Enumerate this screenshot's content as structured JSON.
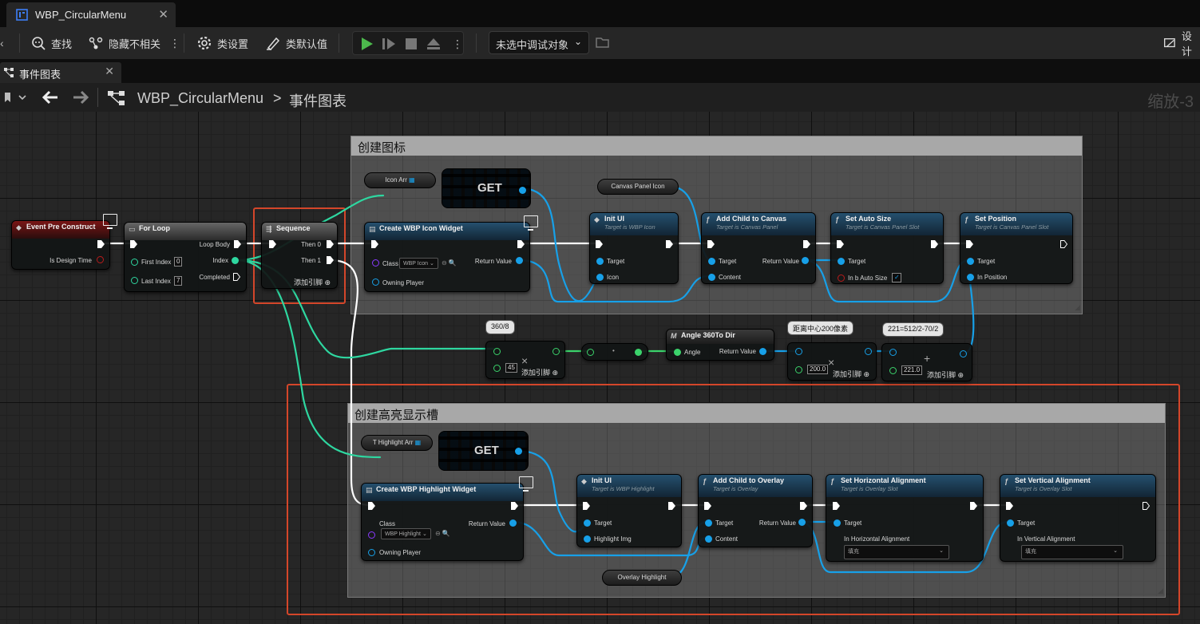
{
  "window": {
    "asset_title": "WBP_CircularMenu",
    "close": "✕"
  },
  "toolbar": {
    "find": "查找",
    "hide_unrelated": "隐藏不相关",
    "class_settings": "类设置",
    "class_defaults": "类默认值",
    "debug_target": "未选中调试对象",
    "designer": "设计",
    "more": "⋮"
  },
  "tabs": {
    "event_graph": "事件图表",
    "close": "✕"
  },
  "breadcrumb": {
    "asset": "WBP_CircularMenu",
    "separator": ">",
    "graph": "事件图表",
    "zoom": "缩放-3"
  },
  "comments": {
    "create_icons": "创建图标",
    "create_highlight": "创建高亮显示槽"
  },
  "nodes": {
    "event_pre_construct": {
      "title": "Event Pre Construct",
      "pin_design_time": "Is Design Time"
    },
    "for_loop": {
      "title": "For Loop",
      "first_index": "First Index",
      "first_index_value": "0",
      "last_index": "Last Index",
      "last_index_value": "7",
      "loop_body": "Loop Body",
      "index": "Index",
      "completed": "Completed"
    },
    "sequence": {
      "title": "Sequence",
      "then0": "Then 0",
      "then1": "Then 1",
      "add_pin": "添加引脚"
    },
    "icon_arr": {
      "label": "Icon Arr"
    },
    "get1": {
      "label": "GET"
    },
    "canvas_panel_icon": {
      "label": "Canvas Panel Icon"
    },
    "create_icon_widget": {
      "title": "Create WBP Icon Widget",
      "class": "Class",
      "class_value": "WBP Icon",
      "owning_player": "Owning Player",
      "return_value": "Return Value"
    },
    "init_ui_1": {
      "title": "Init UI",
      "subtitle": "Target is WBP Icon",
      "target": "Target",
      "icon": "Icon"
    },
    "add_child_canvas": {
      "title": "Add Child to Canvas",
      "subtitle": "Target is Canvas Panel",
      "target": "Target",
      "content": "Content",
      "return_value": "Return Value"
    },
    "set_auto_size": {
      "title": "Set Auto Size",
      "subtitle": "Target is Canvas Panel Slot",
      "target": "Target",
      "in_b_auto_size": "In b Auto Size",
      "checked": "✓"
    },
    "set_position": {
      "title": "Set Position",
      "subtitle": "Target is Canvas Panel Slot",
      "target": "Target",
      "in_position": "In Position"
    },
    "multiply_angle": {
      "comment": "360/8",
      "value": "45",
      "add_pin": "添加引脚",
      "op": "×"
    },
    "convert_node": {
      "op": "•"
    },
    "angle_dir": {
      "title": "Angle 360To Dir",
      "angle": "Angle",
      "return_value": "Return Value"
    },
    "multiply_dist": {
      "comment": "距离中心200像素",
      "value": "200.0",
      "add_pin": "添加引脚",
      "op": "×"
    },
    "add_offset": {
      "comment": "221=512/2-70/2",
      "value": "221.0",
      "add_pin": "添加引脚",
      "op": "+"
    },
    "t_highlight_arr": {
      "label": "T Highlight Arr"
    },
    "get2": {
      "label": "GET"
    },
    "create_highlight_widget": {
      "title": "Create WBP Highlight Widget",
      "class": "Class",
      "class_value": "WBP Highlight",
      "owning_player": "Owning Player",
      "return_value": "Return Value"
    },
    "init_ui_2": {
      "title": "Init UI",
      "subtitle": "Target is WBP Highlight",
      "target": "Target",
      "highlight_img": "Highlight Img"
    },
    "add_child_overlay": {
      "title": "Add Child to Overlay",
      "subtitle": "Target is Overlay",
      "target": "Target",
      "content": "Content",
      "return_value": "Return Value"
    },
    "set_h_align": {
      "title": "Set Horizontal Alignment",
      "subtitle": "Target is Overlay Slot",
      "target": "Target",
      "in_h_align": "In Horizontal Alignment",
      "value": "填充"
    },
    "set_v_align": {
      "title": "Set Vertical Alignment",
      "subtitle": "Target is Overlay Slot",
      "target": "Target",
      "in_v_align": "In Vertical Alignment",
      "value": "填充"
    },
    "overlay_highlight": {
      "label": "Overlay Highlight"
    }
  },
  "colors": {
    "exec_wire": "#ffffff",
    "object_wire": "#17a0e8",
    "float_wire": "#3bd36b",
    "int_wire": "#2ed7a0",
    "comment_frame": "#d4462a"
  }
}
